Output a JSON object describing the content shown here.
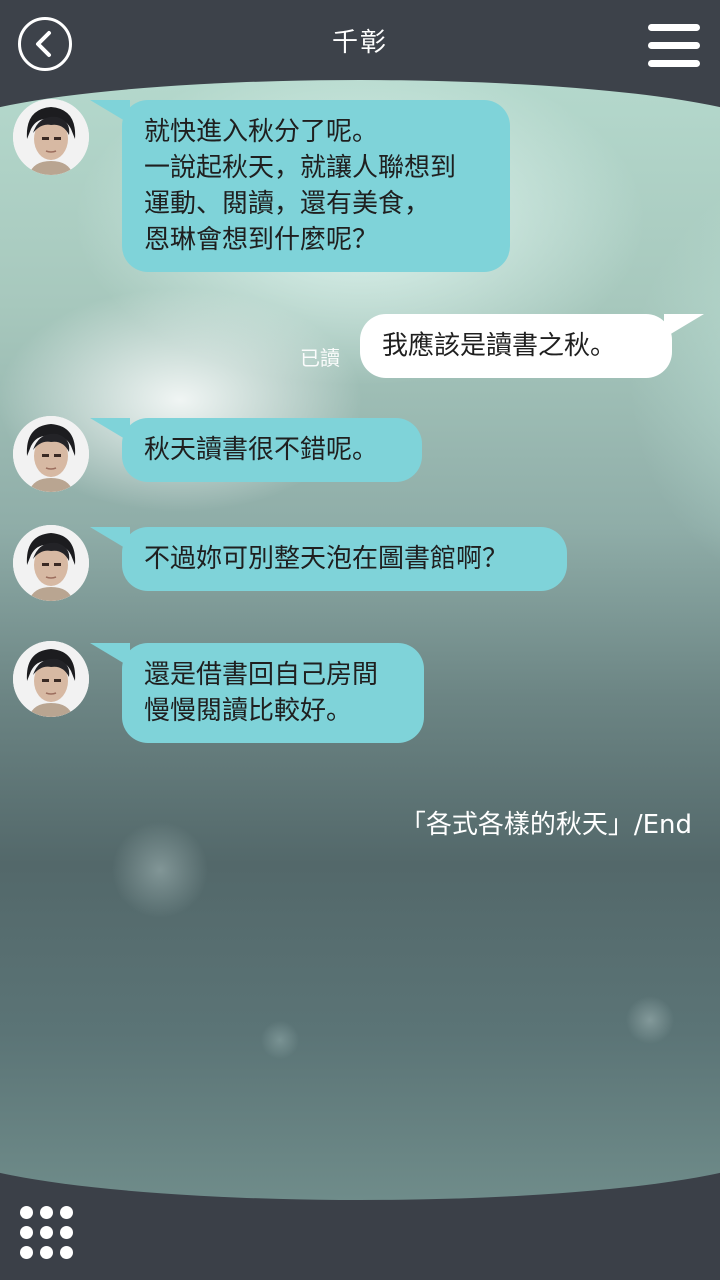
{
  "header": {
    "title": "千彰",
    "back_icon": "chevron-left-icon",
    "menu_icon": "hamburger-menu-icon"
  },
  "messages": [
    {
      "sender": "character",
      "text": "就快進入秋分了呢。\n一說起秋天，就讓人聯想到\n運動、閱讀，還有美食，\n恩琳會想到什麼呢？"
    },
    {
      "sender": "user",
      "text": "我應該是讀書之秋。",
      "status": "已讀"
    },
    {
      "sender": "character",
      "text": "秋天讀書很不錯呢。"
    },
    {
      "sender": "character",
      "text": "不過妳可別整天泡在圖書館啊？"
    },
    {
      "sender": "character",
      "text": "還是借書回自己房間\n慢慢閱讀比較好。"
    }
  ],
  "end_text": "「各式各樣的秋天」/End",
  "footer": {
    "grid_icon": "grid-menu-icon"
  },
  "colors": {
    "header_bg": "#3d424a",
    "character_bubble": "#7fd3d9",
    "user_bubble": "#ffffff"
  }
}
